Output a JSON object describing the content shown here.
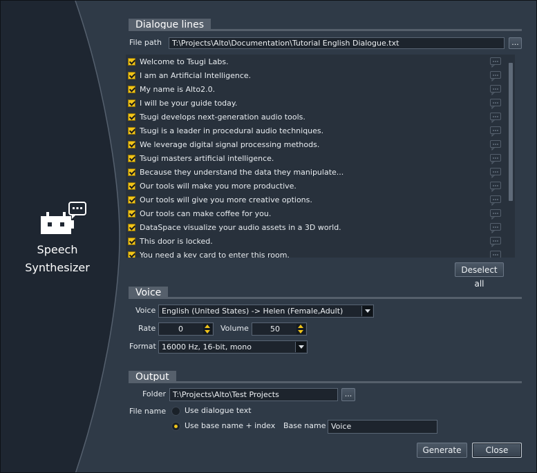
{
  "app": {
    "title_line1": "Speech",
    "title_line2": "Synthesizer",
    "icon": "robot-speech-icon"
  },
  "dialogue": {
    "section_title": "Dialogue lines",
    "file_path_label": "File path",
    "file_path_value": "T:\\Projects\\Alto\\Documentation\\Tutorial English Dialogue.txt",
    "browse_label": "...",
    "lines": [
      {
        "text": "Welcome to Tsugi Labs.",
        "checked": true
      },
      {
        "text": "I am an Artificial Intelligence.",
        "checked": true
      },
      {
        "text": "My name is Alto2.0.",
        "checked": true
      },
      {
        "text": "I will be your guide today.",
        "checked": true
      },
      {
        "text": "Tsugi develops next-generation audio tools.",
        "checked": true
      },
      {
        "text": "Tsugi is a leader in procedural audio techniques.",
        "checked": true
      },
      {
        "text": "We leverage digital signal processing methods.",
        "checked": true
      },
      {
        "text": "Tsugi masters artificial intelligence.",
        "checked": true
      },
      {
        "text": "Because they understand the data they manipulate...",
        "checked": true
      },
      {
        "text": "Our tools will make you more productive.",
        "checked": true
      },
      {
        "text": "Our tools will give you more creative options.",
        "checked": true
      },
      {
        "text": "Our tools can make coffee for you.",
        "checked": true
      },
      {
        "text": "DataSpace visualize your audio assets in a 3D world.",
        "checked": true
      },
      {
        "text": "This door is locked.",
        "checked": true
      },
      {
        "text": "You need a key card to enter this room.",
        "checked": true
      }
    ],
    "deselect_all_label": "Deselect all"
  },
  "voice": {
    "section_title": "Voice",
    "voice_label": "Voice",
    "voice_value": "English (United States)  ->  Helen (Female,Adult)",
    "rate_label": "Rate",
    "rate_value": "0",
    "volume_label": "Volume",
    "volume_value": "50",
    "format_label": "Format",
    "format_value": "16000 Hz, 16-bit, mono"
  },
  "output": {
    "section_title": "Output",
    "folder_label": "Folder",
    "folder_value": "T:\\Projects\\Alto\\Test Projects",
    "browse_label": "...",
    "file_name_label": "File name",
    "option_dialogue_text": "Use dialogue text",
    "option_base_index": "Use base name + index",
    "selected_option": "Use base name + index",
    "base_name_label": "Base name",
    "base_name_value": "Voice"
  },
  "actions": {
    "generate_label": "Generate",
    "close_label": "Close"
  },
  "colors": {
    "accent": "#f0c419",
    "panel": "#2f3a47",
    "sidebar": "#1e2631",
    "header": "#56606c"
  }
}
